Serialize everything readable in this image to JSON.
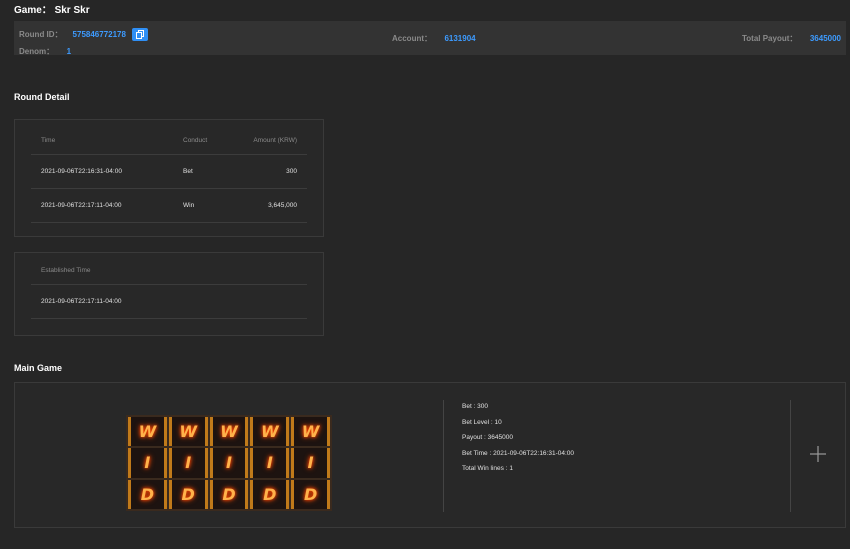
{
  "header": {
    "game_label": "Game：",
    "game_name": "Skr Skr",
    "round_id_label": "Round ID：",
    "round_id": "575846772178",
    "denom_label": "Denom：",
    "denom": "1",
    "account_label": "Account：",
    "account": "6131904",
    "total_payout_label": "Total Payout：",
    "total_payout": "3645000"
  },
  "round_detail": {
    "title": "Round Detail",
    "columns": [
      "Time",
      "Conduct",
      "Amount (KRW)"
    ],
    "rows": [
      {
        "time": "2021-09-06T22:16:31-04:00",
        "conduct": "Bet",
        "amount": "300"
      },
      {
        "time": "2021-09-06T22:17:11-04:00",
        "conduct": "Win",
        "amount": "3,645,000"
      }
    ],
    "established_label": "Established Time",
    "established_time": "2021-09-06T22:17:11-04:00"
  },
  "main_game": {
    "title": "Main Game",
    "reels": [
      [
        "W",
        "W",
        "W",
        "W",
        "W"
      ],
      [
        "I",
        "I",
        "I",
        "I",
        "I"
      ],
      [
        "D",
        "D",
        "D",
        "D",
        "D"
      ]
    ],
    "details": [
      "Bet : 300",
      "Bet Level : 10",
      "Payout : 3645000",
      "Bet Time : 2021-09-06T22:16:31-04:00",
      "Total Win lines : 1"
    ]
  },
  "colors": {
    "accent": "#3d9bff",
    "background": "#262626",
    "bar": "#333333"
  },
  "icons": {
    "copy": "copy-icon",
    "expand": "plus-icon"
  }
}
